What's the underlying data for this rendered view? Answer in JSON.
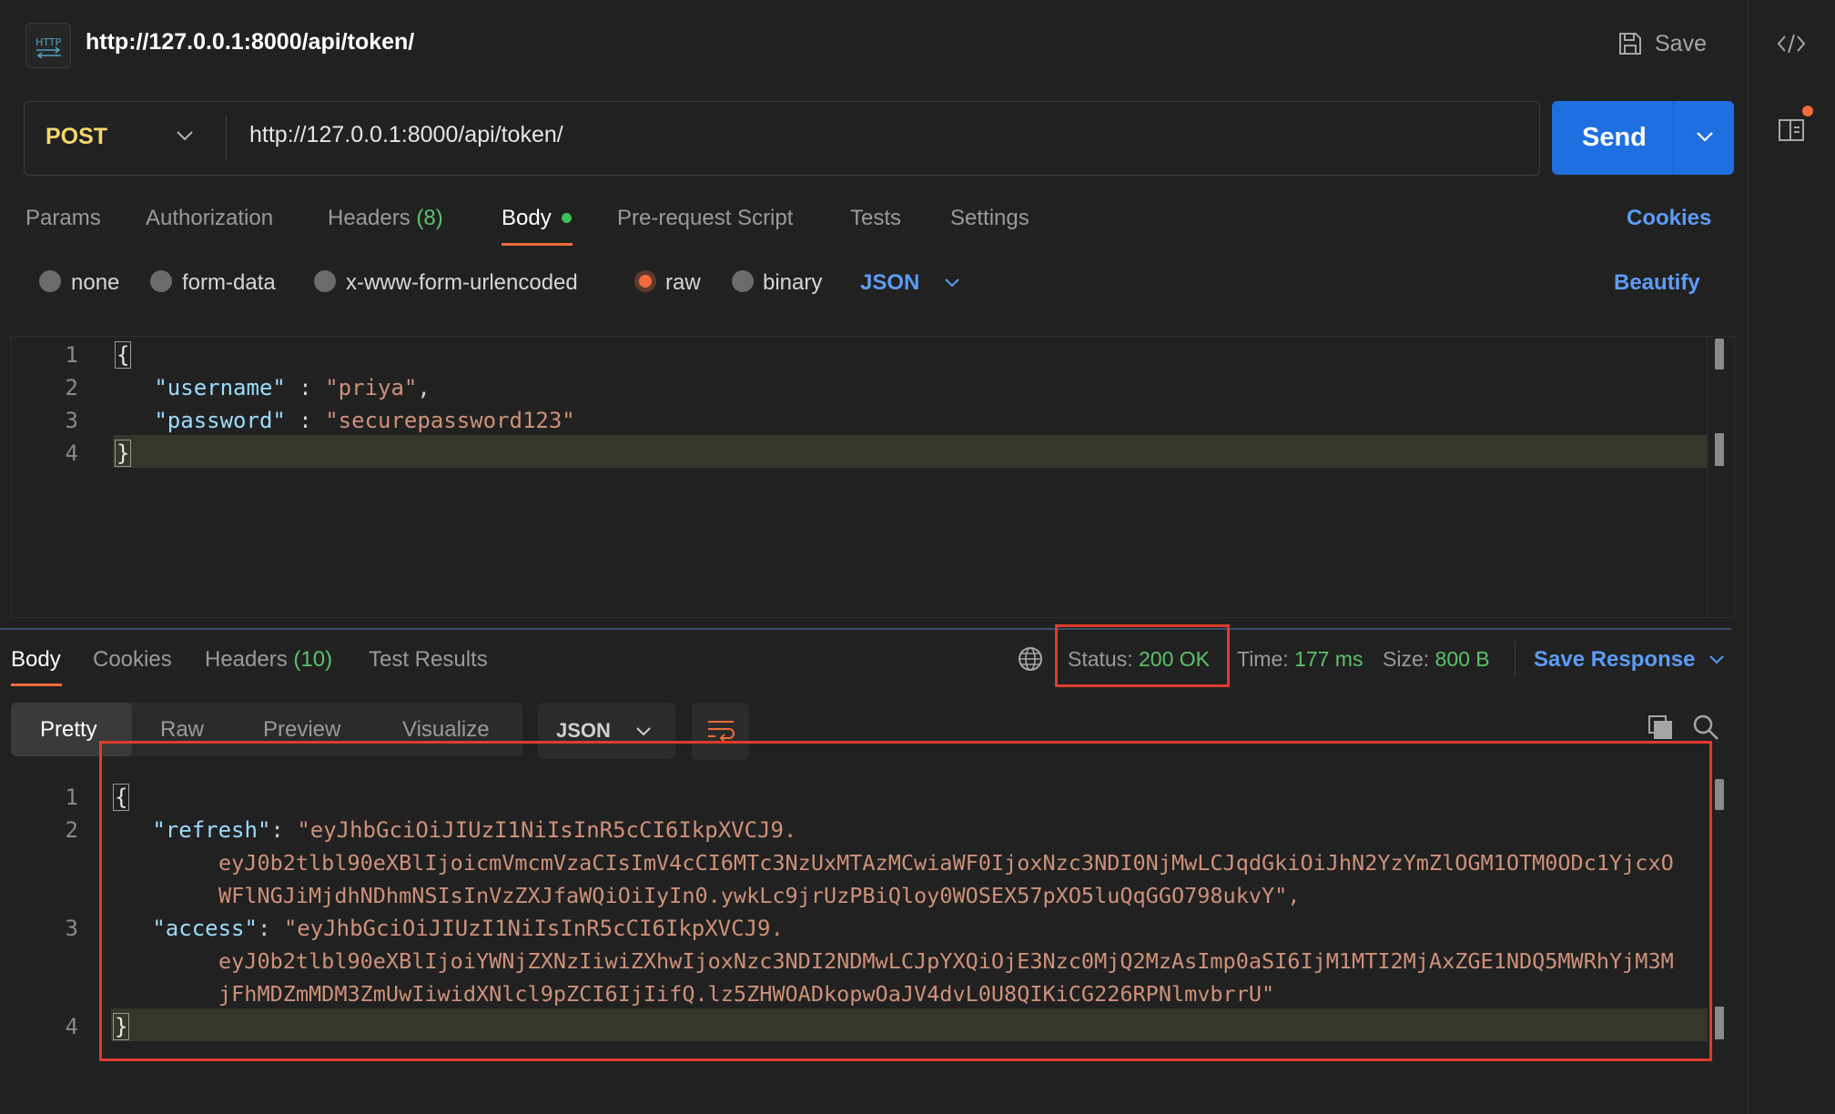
{
  "header": {
    "title": "http://127.0.0.1:8000/api/token/",
    "save_label": "Save",
    "http_icon": "http-icon",
    "save_icon": "floppy-disk-icon"
  },
  "rail": {
    "code_icon": "code-icon",
    "docs_icon": "documentation-icon"
  },
  "request": {
    "method": "POST",
    "url": "http://127.0.0.1:8000/api/token/",
    "send_label": "Send"
  },
  "request_tabs": {
    "params": "Params",
    "authorization": "Authorization",
    "headers": "Headers",
    "headers_count": "(8)",
    "body": "Body",
    "prerequest": "Pre-request Script",
    "tests": "Tests",
    "settings": "Settings",
    "cookies": "Cookies"
  },
  "body_types": {
    "none": "none",
    "form_data": "form-data",
    "urlencoded": "x-www-form-urlencoded",
    "raw": "raw",
    "binary": "binary",
    "selected": "raw",
    "format": "JSON",
    "beautify": "Beautify"
  },
  "request_body": {
    "line_numbers": [
      "1",
      "2",
      "3",
      "4"
    ],
    "open_brace": "{",
    "close_brace": "}",
    "username_key": "\"username\"",
    "username_value": "\"priya\"",
    "password_key": "\"password\"",
    "password_value": "\"securepassword123\""
  },
  "response_tabs": {
    "body": "Body",
    "cookies": "Cookies",
    "headers": "Headers",
    "headers_count": "(10)",
    "test_results": "Test Results"
  },
  "response_meta": {
    "status_label": "Status:",
    "status_value": "200 OK",
    "time_label": "Time:",
    "time_value": "177 ms",
    "size_label": "Size:",
    "size_value": "800 B",
    "save_response": "Save Response"
  },
  "view_modes": {
    "pretty": "Pretty",
    "raw": "Raw",
    "preview": "Preview",
    "visualize": "Visualize",
    "format": "JSON"
  },
  "response_body": {
    "line_numbers": [
      "1",
      "2",
      "3",
      "4"
    ],
    "open_brace": "{",
    "close_brace": "}",
    "refresh_key": "\"refresh\"",
    "refresh_line1": "\"eyJhbGciOiJIUzI1NiIsInR5cCI6IkpXVCJ9.",
    "refresh_line2": "eyJ0b2tlbl90eXBlIjoicmVmcmVzaCIsImV4cCI6MTc3NzUxMTAzMCwiaWF0IjoxNzc3NDI0NjMwLCJqdGkiOiJhN2YzYmZlOGM1OTM0ODc1YjcxO",
    "refresh_line3": "WFlNGJiMjdhNDhmNSIsInVzZXJfaWQiOiIyIn0.ywkLc9jrUzPBiQloy0WOSEX57pXO5luQqGGO798ukvY\",",
    "access_key": "\"access\"",
    "access_line1": "\"eyJhbGciOiJIUzI1NiIsInR5cCI6IkpXVCJ9.",
    "access_line2": "eyJ0b2tlbl90eXBlIjoiYWNjZXNzIiwiZXhwIjoxNzc3NDI2NDMwLCJpYXQiOjE3Nzc0MjQ2MzAsImp0aSI6IjM1MTI2MjAxZGE1NDQ5MWRhYjM3M",
    "access_line3": "jFhMDZmMDM3ZmUwIiwidXNlcl9pZCI6IjIifQ.lz5ZHWOADkopwOaJV4dvL0U8QIKiCG226RPNlmvbrrU\""
  },
  "colors": {
    "background": "#212121",
    "accent_orange": "#f26b3a",
    "send_blue": "#1e6fe0",
    "link_blue": "#5c9cf5",
    "status_green": "#5bc26a",
    "method_yellow": "#f5d76e",
    "json_key": "#9cdcfe",
    "json_string": "#ce9178",
    "highlight_red": "#e03b2a"
  }
}
